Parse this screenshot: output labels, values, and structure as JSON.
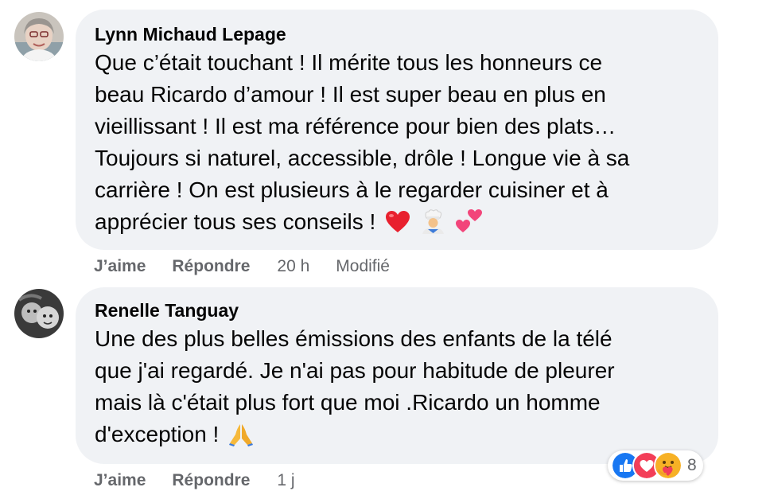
{
  "comments": [
    {
      "author": "Lynn Michaud Lepage",
      "lines": [
        "Que c’était touchant ! Il mérite tous les honneurs ce",
        "beau Ricardo d’amour ! Il est super beau en plus en",
        "vieillissant ! Il est ma référence pour bien des plats…",
        "Toujours si naturel, accessible, drôle ! Longue vie à sa",
        "carrière ! On est plusieurs à le regarder cuisiner et à",
        "apprécier tous ses conseils !"
      ],
      "emojis": [
        "red-heart",
        "man-cook",
        "two-hearts"
      ],
      "like_label": "J’aime",
      "reply_label": "Répondre",
      "time": "20 h",
      "edited_label": "Modifié"
    },
    {
      "author": "Renelle Tanguay",
      "lines": [
        "Une des plus belles émissions des enfants de la télé",
        "que j'ai regardé. Je n'ai pas pour habitude de pleurer",
        "mais là c'était plus fort que moi .Ricardo un homme",
        "d'exception !"
      ],
      "emojis": [
        "folded-hands"
      ],
      "like_label": "J’aime",
      "reply_label": "Répondre",
      "time": "1 j",
      "reactions": {
        "icons": [
          "like-icon",
          "love-icon",
          "care-icon"
        ],
        "count": "8"
      }
    }
  ],
  "colors": {
    "bubble": "#f0f2f5",
    "meta_text": "#65676b",
    "like_blue": "#1877f2",
    "love_red": "#f33e58",
    "care_yellow": "#f7b125"
  }
}
